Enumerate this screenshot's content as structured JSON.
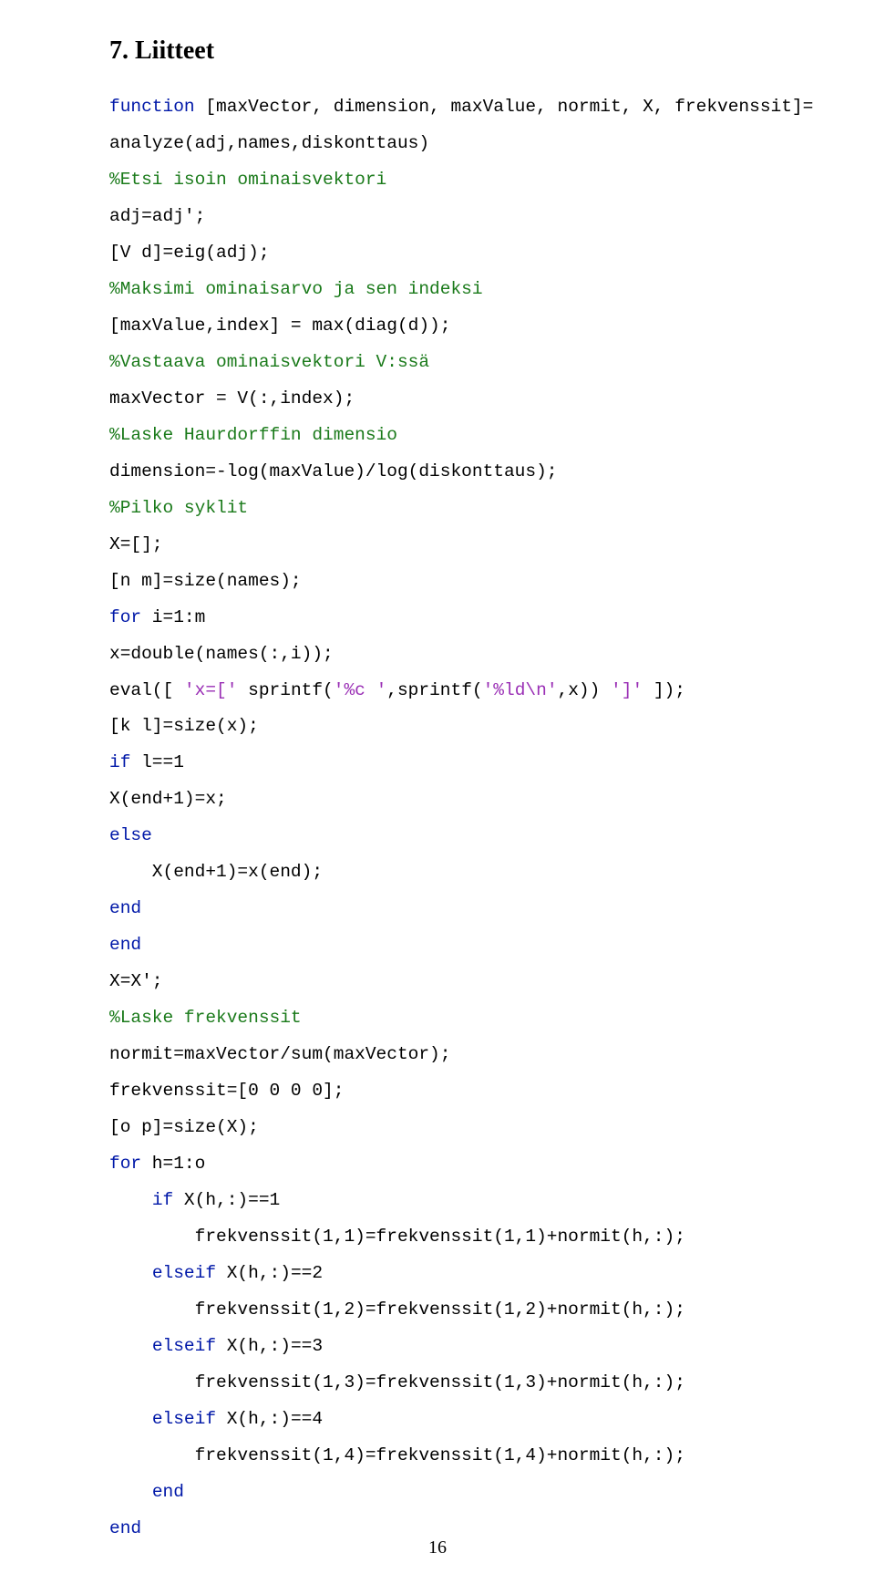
{
  "heading": "7. Liitteet",
  "lines": [
    [
      {
        "t": "kw",
        "v": "function"
      },
      {
        "t": "p",
        "v": " [maxVector, dimension, maxValue, normit, X, frekvenssit]="
      }
    ],
    [
      {
        "t": "p",
        "v": "analyze(adj,names,diskonttaus)"
      }
    ],
    [
      {
        "t": "com",
        "v": "%Etsi isoin ominaisvektori"
      }
    ],
    [
      {
        "t": "p",
        "v": "adj=adj';"
      }
    ],
    [
      {
        "t": "p",
        "v": "[V d]=eig(adj);"
      }
    ],
    [
      {
        "t": "com",
        "v": "%Maksimi ominaisarvo ja sen indeksi"
      }
    ],
    [
      {
        "t": "p",
        "v": "[maxValue,index] = max(diag(d));"
      }
    ],
    [
      {
        "t": "com",
        "v": "%Vastaava ominaisvektori V:ssä"
      }
    ],
    [
      {
        "t": "p",
        "v": "maxVector = V(:,index);"
      }
    ],
    [
      {
        "t": "com",
        "v": "%Laske Haurdorffin dimensio"
      }
    ],
    [
      {
        "t": "p",
        "v": "dimension=-log(maxValue)/log(diskonttaus);"
      }
    ],
    [
      {
        "t": "com",
        "v": "%Pilko syklit"
      }
    ],
    [
      {
        "t": "p",
        "v": "X=[];"
      }
    ],
    [
      {
        "t": "p",
        "v": "[n m]=size(names);"
      }
    ],
    [
      {
        "t": "kw",
        "v": "for"
      },
      {
        "t": "p",
        "v": " i=1:m"
      }
    ],
    [
      {
        "t": "p",
        "v": "x=double(names(:,i));"
      }
    ],
    [
      {
        "t": "p",
        "v": "eval([ "
      },
      {
        "t": "str",
        "v": "'x=['"
      },
      {
        "t": "p",
        "v": " sprintf("
      },
      {
        "t": "str",
        "v": "'%c '"
      },
      {
        "t": "p",
        "v": ",sprintf("
      },
      {
        "t": "str",
        "v": "'%ld\\n'"
      },
      {
        "t": "p",
        "v": ",x)) "
      },
      {
        "t": "str",
        "v": "']'"
      },
      {
        "t": "p",
        "v": " ]);"
      }
    ],
    [
      {
        "t": "p",
        "v": "[k l]=size(x);"
      }
    ],
    [
      {
        "t": "kw",
        "v": "if"
      },
      {
        "t": "p",
        "v": " l==1"
      }
    ],
    [
      {
        "t": "p",
        "v": "X(end+1)=x;"
      }
    ],
    [
      {
        "t": "kw",
        "v": "else"
      }
    ],
    [
      {
        "t": "p",
        "v": "    X(end+1)=x(end);"
      }
    ],
    [
      {
        "t": "kw",
        "v": "end"
      }
    ],
    [
      {
        "t": "kw",
        "v": "end"
      }
    ],
    [
      {
        "t": "p",
        "v": "X=X';"
      }
    ],
    [
      {
        "t": "com",
        "v": "%Laske frekvenssit"
      }
    ],
    [
      {
        "t": "p",
        "v": "normit=maxVector/sum(maxVector);"
      }
    ],
    [
      {
        "t": "p",
        "v": "frekvenssit=[0 0 0 0];"
      }
    ],
    [
      {
        "t": "p",
        "v": "[o p]=size(X);"
      }
    ],
    [
      {
        "t": "kw",
        "v": "for"
      },
      {
        "t": "p",
        "v": " h=1:o"
      }
    ],
    [
      {
        "t": "p",
        "v": "    "
      },
      {
        "t": "kw",
        "v": "if"
      },
      {
        "t": "p",
        "v": " X(h,:)==1"
      }
    ],
    [
      {
        "t": "p",
        "v": "        frekvenssit(1,1)=frekvenssit(1,1)+normit(h,:);"
      }
    ],
    [
      {
        "t": "p",
        "v": "    "
      },
      {
        "t": "kw",
        "v": "elseif"
      },
      {
        "t": "p",
        "v": " X(h,:)==2"
      }
    ],
    [
      {
        "t": "p",
        "v": "        frekvenssit(1,2)=frekvenssit(1,2)+normit(h,:);"
      }
    ],
    [
      {
        "t": "p",
        "v": "    "
      },
      {
        "t": "kw",
        "v": "elseif"
      },
      {
        "t": "p",
        "v": " X(h,:)==3"
      }
    ],
    [
      {
        "t": "p",
        "v": "        frekvenssit(1,3)=frekvenssit(1,3)+normit(h,:);"
      }
    ],
    [
      {
        "t": "p",
        "v": "    "
      },
      {
        "t": "kw",
        "v": "elseif"
      },
      {
        "t": "p",
        "v": " X(h,:)==4"
      }
    ],
    [
      {
        "t": "p",
        "v": "        frekvenssit(1,4)=frekvenssit(1,4)+normit(h,:);"
      }
    ],
    [
      {
        "t": "p",
        "v": "    "
      },
      {
        "t": "kw",
        "v": "end"
      }
    ],
    [
      {
        "t": "kw",
        "v": "end"
      }
    ]
  ],
  "pageNumber": "16"
}
